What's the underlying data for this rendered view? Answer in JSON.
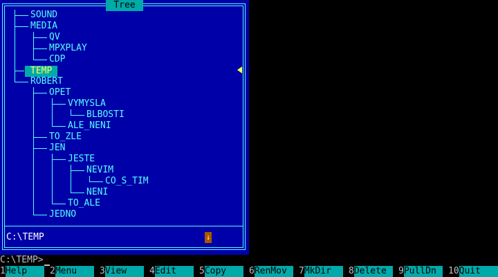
{
  "window": {
    "title": "Tree"
  },
  "tree": {
    "nodes": [
      "SOUND",
      "MEDIA",
      "QV",
      "MPXPLAY",
      "CDP",
      "TEMP",
      "ROBERT",
      "OPET",
      "VYMYSLA",
      "BLBOSTI",
      "ALE_NENI",
      "TO_ZLE",
      "JEN",
      "JESTE",
      "NEVIM",
      "CO_S_TIM",
      "NENI",
      "TO_ALE",
      "JEDNO"
    ],
    "selected": "TEMP"
  },
  "status": {
    "path": "C:\\TEMP",
    "indicator": "↓"
  },
  "prompt": {
    "text": "C:\\TEMP>"
  },
  "fkeys": [
    {
      "num": "1",
      "label": "Help"
    },
    {
      "num": "2",
      "label": "Menu"
    },
    {
      "num": "3",
      "label": "View"
    },
    {
      "num": "4",
      "label": "Edit"
    },
    {
      "num": "5",
      "label": "Copy"
    },
    {
      "num": "6",
      "label": "RenMov"
    },
    {
      "num": "7",
      "label": "MkDir"
    },
    {
      "num": "8",
      "label": "Delete"
    },
    {
      "num": "9",
      "label": "PullDn"
    },
    {
      "num": "10",
      "label": "Quit"
    }
  ],
  "colors": {
    "panel": "#0000a8",
    "accent": "#55ffff",
    "selection": "#00aaaa",
    "selection_text": "#ffff55",
    "fkey_label": "#00aaaa"
  }
}
